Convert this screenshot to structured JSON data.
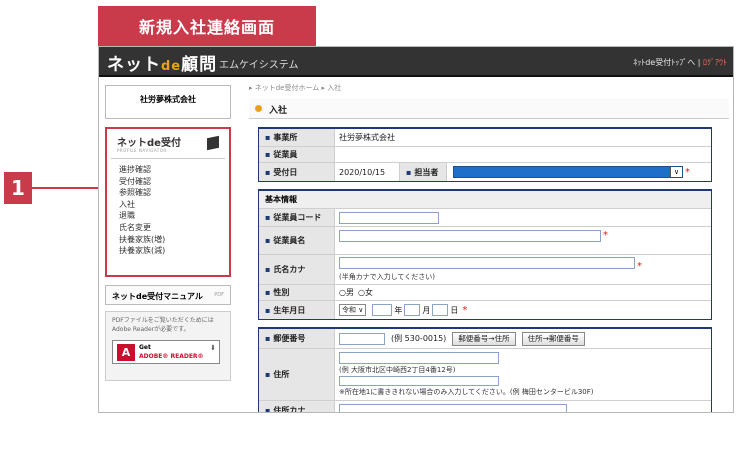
{
  "title_tab": "新規入社連絡画面",
  "callout_number": "1",
  "app": {
    "logo_main": "ネット",
    "logo_de": "de",
    "logo_rest": "顧問",
    "company_name": "エムケイシステム",
    "link_top": "ﾈｯﾄde受付ﾄｯﾌﾟへ",
    "link_separator": "|",
    "link_logout": "ﾛｸﾞｱｳﾄ"
  },
  "sidebar": {
    "office": "社労夢株式会社",
    "menu_title": "ネットde受付",
    "menu_subtitle": "PROFILE NAVIGATOR",
    "items": [
      "進捗確認",
      "受付確認",
      "参照確認",
      "入社",
      "退職",
      "氏名変更",
      "扶養家族(増)",
      "扶養家族(減)"
    ],
    "manual_label": "ネットde受付マニュアル",
    "manual_pdf": "PDF",
    "adobe_note_1": "PDFファイルをご覧いただくためには",
    "adobe_note_2": "Adobe Readerが必要です。",
    "adobe_get": "Get",
    "adobe_reader": "ADOBE® READER®"
  },
  "main": {
    "breadcrumb": "▸ ネットde受付ホーム ▸ 入社",
    "page_title": "入社",
    "top_section": {
      "office_label": "事業所",
      "office_value": "社労夢株式会社",
      "employee_label": "従業員",
      "date_label": "受付日",
      "date_value": "2020/10/15",
      "person_label": "担当者",
      "person_arrow": "∨",
      "required": "*"
    },
    "basic": {
      "section_title": "基本情報",
      "code_label": "従業員コード",
      "name_label": "従業員名",
      "kana_label": "氏名カナ",
      "kana_hint": "(半角カナで入力してください)",
      "gender_label": "性別",
      "gender_male": "○男",
      "gender_female": "○女",
      "birth_label": "生年月日",
      "era_value": "令和 ∨",
      "year": "年",
      "month": "月",
      "day": "日"
    },
    "address": {
      "zip_label": "郵便番号",
      "zip_example": "(例 530-0015)",
      "btn_zip_to_addr": "郵便番号→住所",
      "btn_addr_to_zip": "住所→郵便番号",
      "addr_label": "住所",
      "addr_example": "(例 大阪市北区中崎西2丁目4番12号)",
      "addr_note": "※所在地1に書ききれない場合のみ入力してください。(例 梅田センタービル30F)",
      "addr_kana_label": "住所カナ"
    }
  }
}
